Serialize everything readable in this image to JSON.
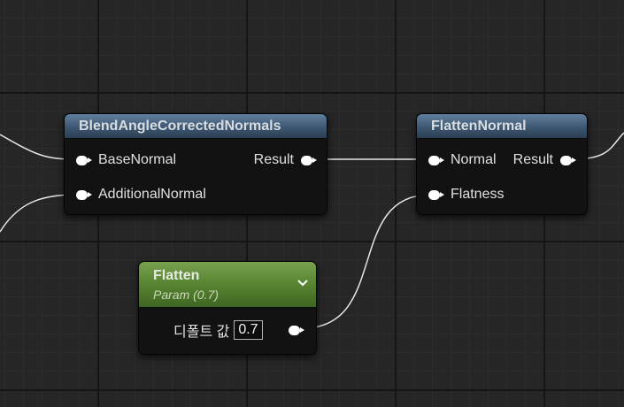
{
  "nodes": {
    "blend": {
      "title": "BlendAngleCorrectedNormals",
      "inputs": [
        "BaseNormal",
        "AdditionalNormal"
      ],
      "output": "Result"
    },
    "flatten_normal": {
      "title": "FlattenNormal",
      "inputs": [
        "Normal",
        "Flatness"
      ],
      "output": "Result"
    },
    "param": {
      "title": "Flatten",
      "subtitle": "Param (0.7)",
      "default_label": "디폴트 값",
      "default_value": "0.7"
    }
  },
  "colors": {
    "background": "#262626",
    "material_header": "#4f6b87",
    "param_header": "#5a8733",
    "pin": "#ffffff",
    "wire": "#e6e6e6"
  },
  "icons": [
    "pin-icon",
    "chevron-down-icon"
  ]
}
